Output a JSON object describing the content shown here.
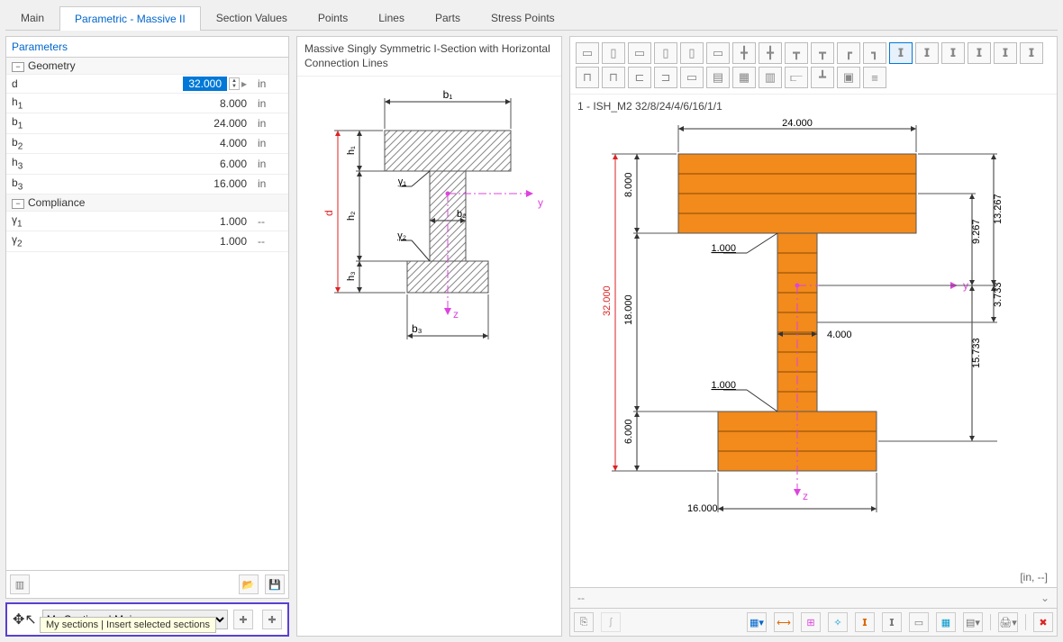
{
  "tabs": [
    "Main",
    "Parametric - Massive II",
    "Section Values",
    "Points",
    "Lines",
    "Parts",
    "Stress Points"
  ],
  "active_tab": 1,
  "left": {
    "title": "Parameters",
    "groups": [
      {
        "name": "Geometry",
        "rows": [
          {
            "name_html": "d",
            "value": "32.000",
            "unit": "in",
            "editing": true
          },
          {
            "name_html": "h<sub>1</sub>",
            "value": "8.000",
            "unit": "in"
          },
          {
            "name_html": "b<sub>1</sub>",
            "value": "24.000",
            "unit": "in"
          },
          {
            "name_html": "b<sub>2</sub>",
            "value": "4.000",
            "unit": "in"
          },
          {
            "name_html": "h<sub>3</sub>",
            "value": "6.000",
            "unit": "in"
          },
          {
            "name_html": "b<sub>3</sub>",
            "value": "16.000",
            "unit": "in"
          }
        ]
      },
      {
        "name": "Compliance",
        "rows": [
          {
            "name_html": "γ<sub>1</sub>",
            "value": "1.000",
            "unit": "--"
          },
          {
            "name_html": "γ<sub>2</sub>",
            "value": "1.000",
            "unit": "--"
          }
        ]
      }
    ]
  },
  "mid": {
    "title": "Massive Singly Symmetric I-Section with Horizontal Connection Lines",
    "labels": {
      "d": "d",
      "h1": "h₁",
      "h2": "h₂",
      "h3": "h₃",
      "b1": "b₁",
      "b2": "b₂",
      "b3": "b₃",
      "g1": "γ₁",
      "g2": "γ₂",
      "y": "y",
      "z": "z"
    }
  },
  "right": {
    "section_name": "1 - ISH_M2 32/8/24/4/6/16/1/1",
    "dims": {
      "b1": "24.000",
      "b2": "4.000",
      "b3": "16.000",
      "d": "32.000",
      "h1": "8.000",
      "h2": "18.000",
      "h3": "6.000",
      "g1": "1.000",
      "g2": "1.000",
      "cy": "9.267",
      "cz1": "13.267",
      "cz2": "15.733",
      "cz3": "3.733"
    },
    "axes": {
      "y": "y",
      "z": "z"
    },
    "units": "[in, --]",
    "status": "--",
    "shape_icons": [
      "▭",
      "▯",
      "▭",
      "▯",
      "▯",
      "▭",
      "╋",
      "╋",
      "┳",
      "┳",
      "┏",
      "┓",
      "𝗜",
      "𝗜",
      "𝗜",
      "𝗜",
      "𝗜",
      "𝗜",
      "⊓",
      "⊓",
      "⊏",
      "⊐",
      "▭",
      "▤",
      "▦",
      "▥",
      "⫍",
      "┻",
      "▣",
      "≡"
    ],
    "active_shape": 12
  },
  "my_sections": {
    "dropdown": "My Sections | Main",
    "tooltip": "My sections | Insert selected sections"
  }
}
